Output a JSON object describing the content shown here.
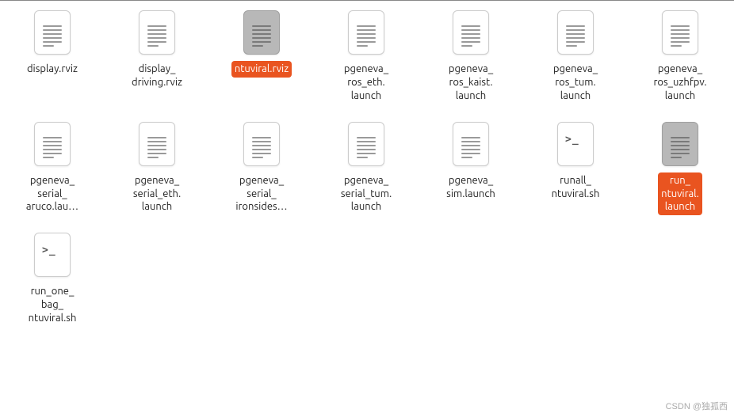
{
  "files": [
    {
      "name": "display.rviz",
      "icon": "text",
      "selected": false
    },
    {
      "name": "display_\ndriving.rviz",
      "icon": "text",
      "selected": false
    },
    {
      "name": "ntuviral.rviz",
      "icon": "text",
      "selected": true
    },
    {
      "name": "pgeneva_\nros_eth.\nlaunch",
      "icon": "text",
      "selected": false
    },
    {
      "name": "pgeneva_\nros_kaist.\nlaunch",
      "icon": "text",
      "selected": false
    },
    {
      "name": "pgeneva_\nros_tum.\nlaunch",
      "icon": "text",
      "selected": false
    },
    {
      "name": "pgeneva_\nros_uzhfpv.\nlaunch",
      "icon": "text",
      "selected": false
    },
    {
      "name": "pgeneva_\nserial_\naruco.lau…",
      "icon": "text",
      "selected": false
    },
    {
      "name": "pgeneva_\nserial_eth.\nlaunch",
      "icon": "text",
      "selected": false
    },
    {
      "name": "pgeneva_\nserial_\nironsides…",
      "icon": "text",
      "selected": false
    },
    {
      "name": "pgeneva_\nserial_tum.\nlaunch",
      "icon": "text",
      "selected": false
    },
    {
      "name": "pgeneva_\nsim.launch",
      "icon": "text",
      "selected": false
    },
    {
      "name": "runall_\nntuviral.sh",
      "icon": "shell",
      "selected": false
    },
    {
      "name": "run_\nntuviral.\nlaunch",
      "icon": "text",
      "selected": true
    },
    {
      "name": "run_one_\nbag_\nntuviral.sh",
      "icon": "shell",
      "selected": false
    }
  ],
  "watermark": "CSDN @独孤西",
  "shell_prompt": ">_"
}
